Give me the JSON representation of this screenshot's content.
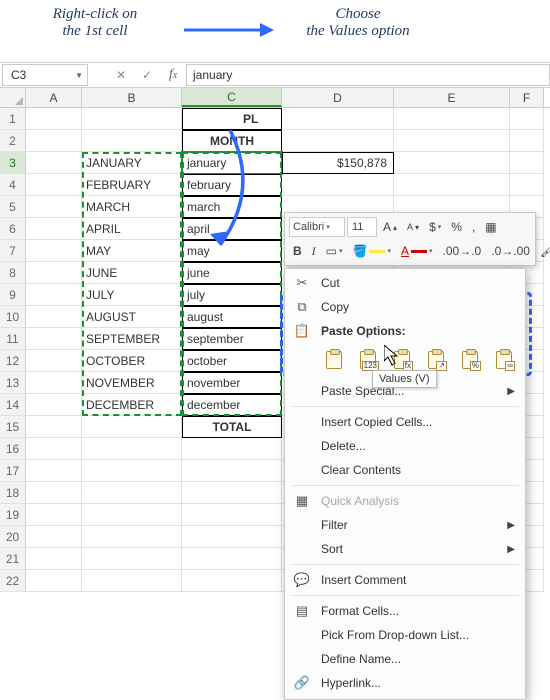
{
  "annotations": {
    "left": "Right-click on\nthe 1st cell",
    "right": "Choose\nthe Values option"
  },
  "namebox": {
    "ref": "C3"
  },
  "formula_bar": {
    "value": "january"
  },
  "columns": [
    "A",
    "B",
    "C",
    "D",
    "E",
    "F"
  ],
  "rows": [
    1,
    2,
    3,
    4,
    5,
    6,
    7,
    8,
    9,
    10,
    11,
    12,
    13,
    14,
    15,
    16,
    17,
    18,
    19,
    20,
    21,
    22
  ],
  "header_cells": {
    "C1": "PL",
    "C2": "MONTH",
    "D3": "$150,878"
  },
  "months_b": [
    "JANUARY",
    "FEBRUARY",
    "MARCH",
    "APRIL",
    "MAY",
    "JUNE",
    "JULY",
    "AUGUST",
    "SEPTEMBER",
    "OCTOBER",
    "NOVEMBER",
    "DECEMBER"
  ],
  "months_c": [
    "january",
    "february",
    "march",
    "april",
    "may",
    "june",
    "july",
    "august",
    "september",
    "october",
    "november",
    "december"
  ],
  "total_label": "TOTAL",
  "mini_toolbar": {
    "font": "Calibri",
    "size": "11"
  },
  "context_menu": {
    "cut": "Cut",
    "copy": "Copy",
    "paste_options": "Paste Options:",
    "paste_buttons": [
      {
        "name": "paste",
        "tag": ""
      },
      {
        "name": "values",
        "tag": "123"
      },
      {
        "name": "formulas",
        "tag": "fx"
      },
      {
        "name": "transpose",
        "tag": "↗"
      },
      {
        "name": "formatting",
        "tag": "%"
      },
      {
        "name": "link",
        "tag": "∞"
      }
    ],
    "paste_special": "Paste Special...",
    "insert_copied": "Insert Copied Cells...",
    "delete": "Delete...",
    "clear": "Clear Contents",
    "quick": "Quick Analysis",
    "filter": "Filter",
    "sort": "Sort",
    "insert_comment": "Insert Comment",
    "format_cells": "Format Cells...",
    "pick_list": "Pick From Drop-down List...",
    "define_name": "Define Name...",
    "hyperlink": "Hyperlink..."
  },
  "tooltip": "Values (V)",
  "chart_data": null
}
